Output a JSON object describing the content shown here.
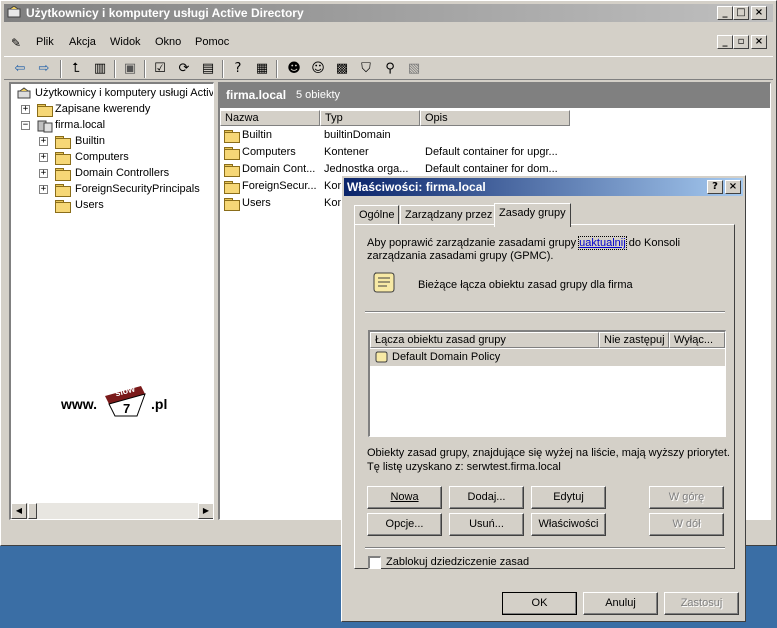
{
  "main_window": {
    "title": "Użytkownicy i komputery usługi Active Directory",
    "menu": [
      "Plik",
      "Akcja",
      "Widok",
      "Okno",
      "Pomoc"
    ]
  },
  "tree": {
    "root": "Użytkownicy i komputery usługi Activ",
    "saved_queries": "Zapisane kwerendy",
    "domain": "firma.local",
    "children": [
      "Builtin",
      "Computers",
      "Domain Controllers",
      "ForeignSecurityPrincipals",
      "Users"
    ]
  },
  "watermark": {
    "prefix": "www.",
    "tag": "slow",
    "number": "7",
    "suffix": ".pl"
  },
  "list": {
    "header_title": "firma.local",
    "header_count": "5 obiekty",
    "columns": [
      "Nazwa",
      "Typ",
      "Opis"
    ],
    "rows": [
      {
        "name": "Builtin",
        "type": "builtinDomain",
        "desc": ""
      },
      {
        "name": "Computers",
        "type": "Kontener",
        "desc": "Default container for upgr..."
      },
      {
        "name": "Domain Cont...",
        "type": "Jednostka orga...",
        "desc": "Default container for dom..."
      },
      {
        "name": "ForeignSecur...",
        "type": "Kon",
        "desc": ""
      },
      {
        "name": "Users",
        "type": "Kon",
        "desc": ""
      }
    ]
  },
  "dialog": {
    "title": "Właściwości: firma.local",
    "tabs": [
      "Ogólne",
      "Zarządzany przez",
      "Zasady grupy"
    ],
    "info_line1_pre": "Aby poprawić zarządzanie zasadami grupy ",
    "info_link": "uaktualnij",
    "info_line1_post": " do Konsoli",
    "info_line2": "zarządzania zasadami grupy (GPMC).",
    "current_links": "Bieżące łącza obiektu zasad grupy dla firma",
    "gpo_columns": [
      "Łącza obiektu zasad grupy",
      "Nie zastępuj",
      "Wyłąc..."
    ],
    "gpo_items": [
      "Default Domain Policy"
    ],
    "priority_note": "Obiekty zasad grupy, znajdujące się wyżej na liście, mają wyższy priorytet.",
    "source_note": "Tę listę uzyskano z: serwtest.firma.local",
    "buttons": {
      "new": "Nowa",
      "add": "Dodaj...",
      "edit": "Edytuj",
      "up": "W górę",
      "options": "Opcje...",
      "remove": "Usuń...",
      "properties": "Właściwości",
      "down": "W dół"
    },
    "block_inheritance": "Zablokuj dziedziczenie zasad",
    "ok": "OK",
    "cancel": "Anuluj",
    "apply": "Zastosuj"
  }
}
